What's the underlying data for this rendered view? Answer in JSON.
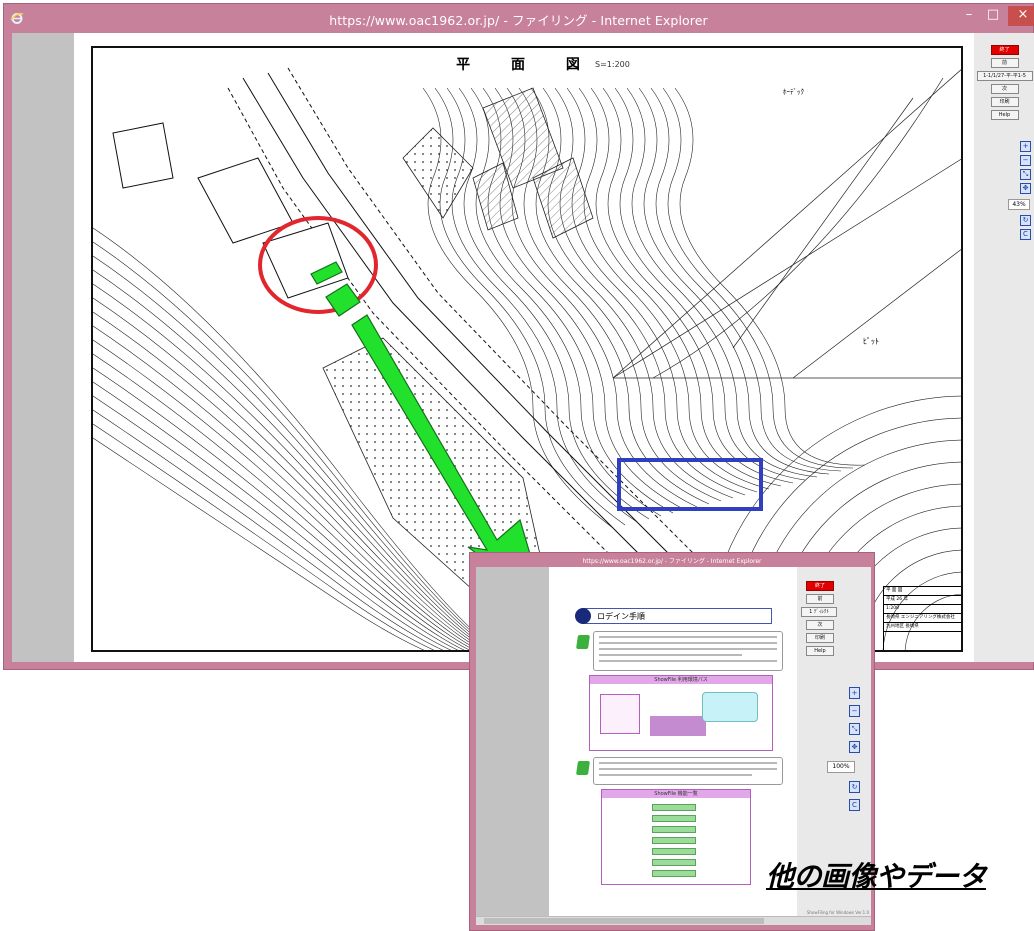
{
  "main_window": {
    "title": "https://www.oac1962.or.jp/ - ファイリング - Internet Explorer",
    "controls": {
      "minimize": "–",
      "maximize": "□",
      "close": "×"
    }
  },
  "drawing": {
    "title": "平 面 図",
    "scale": "S=1:200",
    "labels": {
      "room": "ﾎｰﾃﾞｯｸ",
      "pit": "ﾋﾟｯﾄ"
    },
    "title_block": {
      "row1": "平 面 図",
      "row2": "平成 26 年",
      "row3": "1:200",
      "row4": "長崎県 エンジニアリング株式会社",
      "row5": "九州地区 長崎県"
    }
  },
  "right_toolbar": {
    "top_button": "終了",
    "b1": "前",
    "page_select": "1-1/1/27-平-平1-5",
    "b2": "次",
    "b3": "印刷",
    "help": "Help",
    "zoom_level": "43%",
    "icons": [
      "zoom-in-icon",
      "zoom-out-icon",
      "fit-icon",
      "pan-icon",
      "rotate-icon",
      "clear-icon"
    ]
  },
  "annotations": {
    "circle_color": "#e1262e",
    "rect_color": "#2f3fbf",
    "arrow_color": "#22e12d"
  },
  "inset_window": {
    "title": "https://www.oac1962.or.jp/ - ファイリング - Internet Explorer",
    "heading": "ロデイン手順",
    "section1_caption": "ShowFile 利用環境パス",
    "section2_caption": "ShowFile 機能一覧",
    "buttons": {
      "top": "終了",
      "b1": "前",
      "select": "1 ﾃﾞｨﾚｸﾄ",
      "b2": "次",
      "b3": "印刷",
      "help": "Help"
    },
    "zoom_level": "100%",
    "status": "ShowFiling for Windows Ver.1.0"
  },
  "caption": "他の画像やデータ"
}
